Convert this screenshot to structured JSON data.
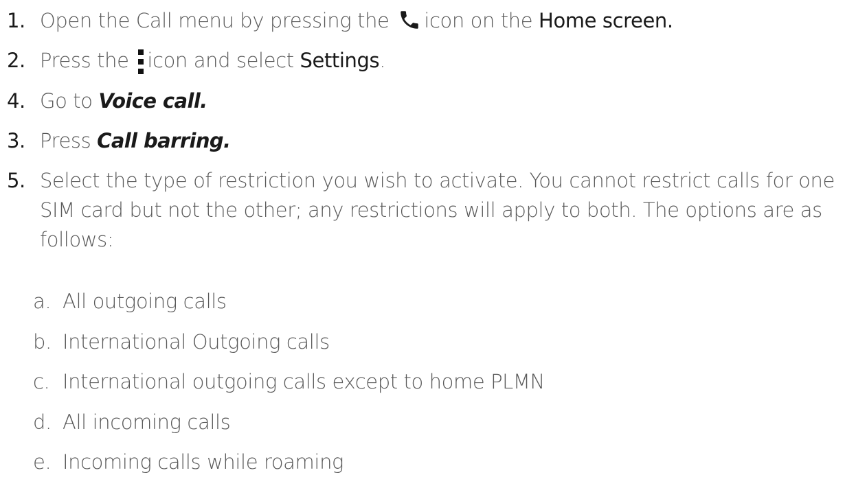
{
  "steps": [
    {
      "number": "1.",
      "pre": "Open the Call menu by pressing the",
      "icon": "phone-icon",
      "post": "icon on the",
      "strong": "Home screen."
    },
    {
      "number": "2.",
      "pre": "Press the",
      "icon": "more-options-icon",
      "post": "icon and select",
      "strong": "Settings",
      "end": "."
    },
    {
      "number": "4.",
      "pre": "Go to",
      "emphasis": "Voice call."
    },
    {
      "number": "3.",
      "pre": "Press",
      "emphasis": "Call barring."
    },
    {
      "number": "5.",
      "text": "Select the type of restriction you wish to activate. You cannot restrict calls for one SIM card but not the other; any restrictions will apply to both. The options are as follows:"
    }
  ],
  "options": [
    {
      "letter": "a.",
      "label": "All outgoing calls"
    },
    {
      "letter": "b.",
      "label": "International Outgoing calls"
    },
    {
      "letter": "c.",
      "label": "International outgoing calls except to home PLMN"
    },
    {
      "letter": "d.",
      "label": "All incoming calls"
    },
    {
      "letter": "e.",
      "label": "Incoming calls while roaming"
    }
  ]
}
